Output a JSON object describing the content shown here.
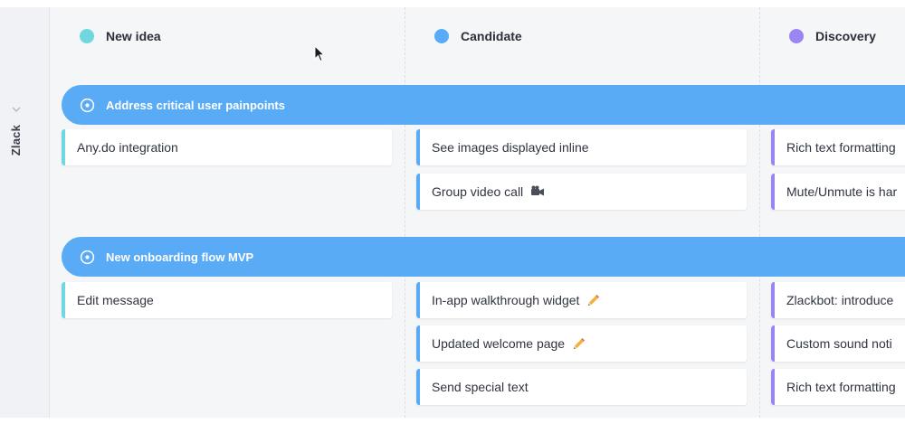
{
  "colors": {
    "new_idea": "#6ed8dc",
    "candidate": "#5aabf6",
    "discovery": "#9a86f2",
    "initiative_bar": "#5aabf6"
  },
  "group": {
    "label": "Zlack",
    "collapse_icon": "chevron-down-icon"
  },
  "columns": [
    {
      "label": "New idea"
    },
    {
      "label": "Candidate"
    },
    {
      "label": "Discovery"
    }
  ],
  "initiatives": [
    {
      "label": "Address critical user painpoints",
      "icon": "target-icon",
      "cards": {
        "new_idea": [
          "Any.do integration"
        ],
        "candidate": [
          "See images displayed inline",
          "Group video call"
        ],
        "discovery": [
          "Rich text formatting",
          "Mute/Unmute is har"
        ]
      }
    },
    {
      "label": "New onboarding flow MVP",
      "icon": "target-icon",
      "cards": {
        "new_idea": [
          "Edit message"
        ],
        "candidate": [
          "In-app walkthrough widget",
          "Updated welcome page",
          "Send special text"
        ],
        "discovery": [
          "Zlackbot: introduce",
          "Custom sound noti",
          "Rich text formatting"
        ]
      }
    }
  ],
  "card_icons": {
    "group_video_call": "video-camera-icon",
    "in_app_walkthrough_widget": "pencil-icon",
    "updated_welcome_page": "pencil-icon"
  }
}
